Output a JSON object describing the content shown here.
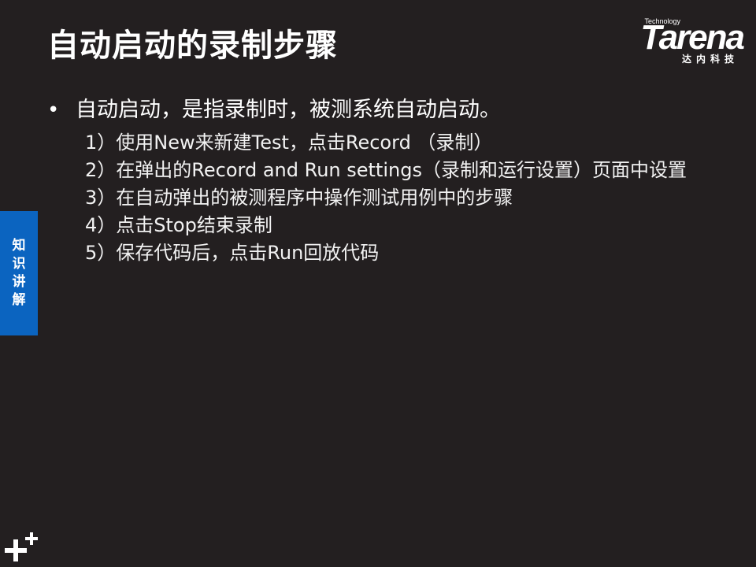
{
  "slide": {
    "title": "自动启动的录制步骤"
  },
  "logo": {
    "small_text": "Technology",
    "brand": "Tarena",
    "chinese": "达内科技"
  },
  "content": {
    "bullet_glyph": "•",
    "bullet_text": "自动启动，是指录制时，被测系统自动启动。",
    "steps": [
      "1）使用New来新建Test，点击Record （录制）",
      "2）在弹出的Record and Run settings（录制和运行设置）页面中设置",
      "3）在自动弹出的被测程序中操作测试用例中的步骤",
      "4）点击Stop结束录制",
      "5）保存代码后，点击Run回放代码"
    ]
  },
  "side_tab": {
    "chars": [
      "知",
      "识",
      "讲",
      "解"
    ]
  },
  "colors": {
    "background": "#231f20",
    "text": "#ffffff",
    "side_tab": "#0b64c0"
  },
  "icons": {
    "bottom_left": "plus-plus-icon"
  }
}
